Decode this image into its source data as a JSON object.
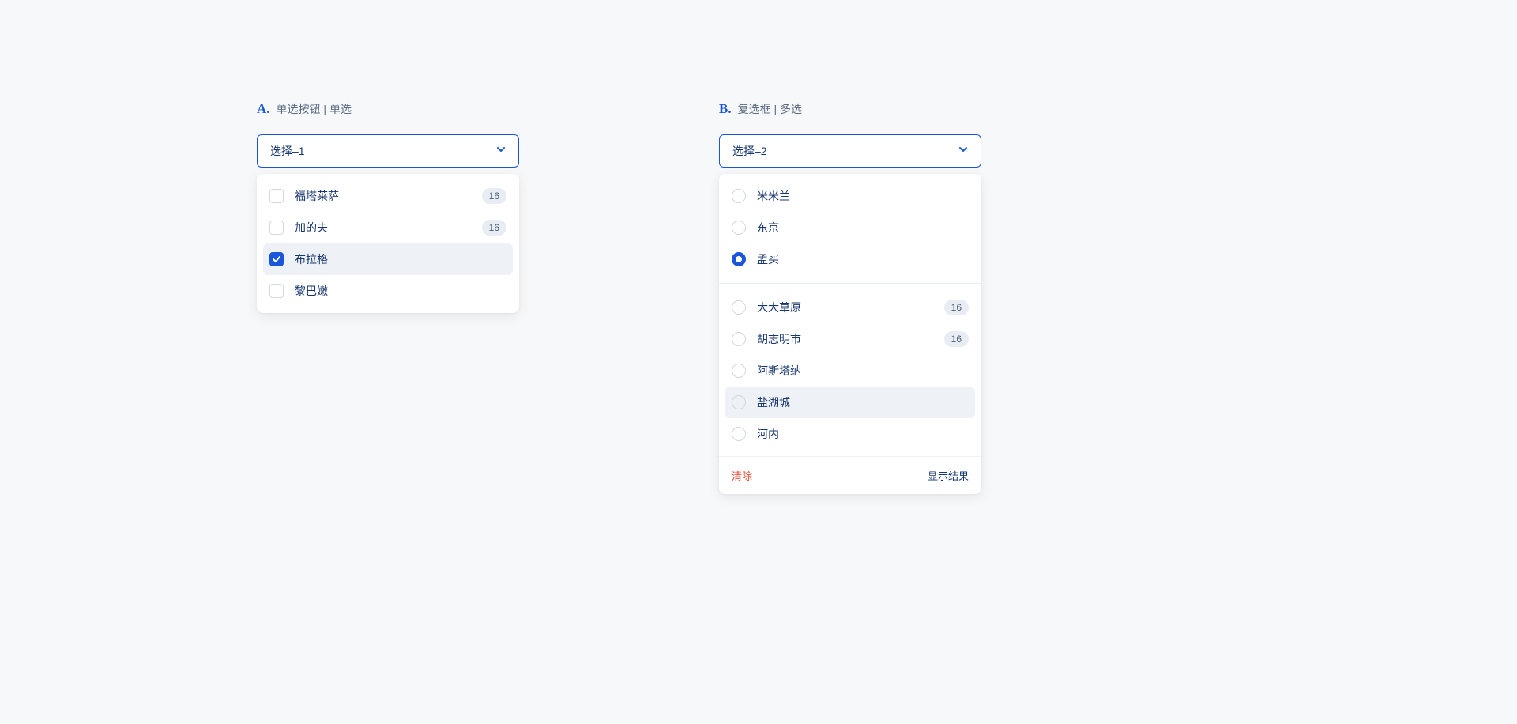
{
  "sectionA": {
    "letter": "A.",
    "title": "单选按钮 | 单选",
    "placeholder": "选择–1",
    "options": [
      {
        "label": "福塔莱萨",
        "badge": "16",
        "checked": false,
        "highlighted": false
      },
      {
        "label": "加的夫",
        "badge": "16",
        "checked": false,
        "highlighted": false
      },
      {
        "label": "布拉格",
        "badge": null,
        "checked": true,
        "highlighted": true
      },
      {
        "label": "黎巴嫩",
        "badge": null,
        "checked": false,
        "highlighted": false
      }
    ]
  },
  "sectionB": {
    "letter": "B.",
    "title": "复选框 | 多选",
    "placeholder": "选择–2",
    "group1": [
      {
        "label": "米米兰",
        "badge": null,
        "checked": false,
        "highlighted": false
      },
      {
        "label": "东京",
        "badge": null,
        "checked": false,
        "highlighted": false
      },
      {
        "label": "孟买",
        "badge": null,
        "checked": true,
        "highlighted": false
      }
    ],
    "group2": [
      {
        "label": "大大草原",
        "badge": "16",
        "checked": false,
        "highlighted": false
      },
      {
        "label": "胡志明市",
        "badge": "16",
        "checked": false,
        "highlighted": false
      },
      {
        "label": "阿斯塔纳",
        "badge": null,
        "checked": false,
        "highlighted": false
      },
      {
        "label": "盐湖城",
        "badge": null,
        "checked": false,
        "highlighted": true
      },
      {
        "label": "河内",
        "badge": null,
        "checked": false,
        "highlighted": false
      }
    ],
    "footer": {
      "clear": "清除",
      "result": "显示结果"
    }
  }
}
